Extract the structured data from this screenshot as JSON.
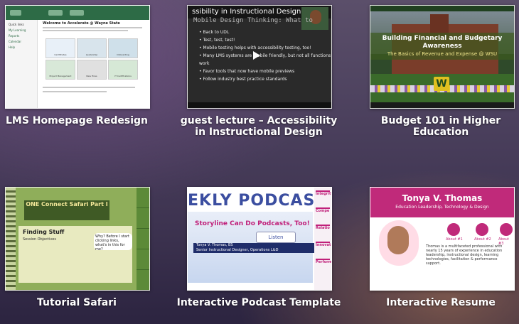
{
  "portfolio": {
    "items": [
      {
        "title": "LMS Homepage Redesign",
        "thumb": {
          "heading": "Welcome to Accelerate @ Wayne State",
          "side_items": [
            "Quick links",
            "My Learning",
            "Reports",
            "Calendar",
            "Help"
          ],
          "tiles": [
            "Certificates",
            "Leadership",
            "Onboarding",
            "Project Management",
            "New Hires",
            "IT Certifications"
          ]
        }
      },
      {
        "title": "guest lecture – Accessibility in Instructional Design",
        "thumb": {
          "bar_title": "ssibility in Instructional Designer",
          "slide_heading": "Mobile Design Thinking: What to",
          "bullets": [
            "Back to UDL",
            "Test, test, test!",
            "Mobile testing helps with accessibility testing, too!",
            "Many LMS systems are mobile friendly, but not all functions work",
            "Favor tools that now have mobile previews",
            "Follow industry best practice standards"
          ]
        }
      },
      {
        "title": "Budget 101 in Higher Education",
        "thumb": {
          "heading": "Building Financial and Budgetary Awareness",
          "subheading": "The Basics of Revenue and Expense @ WSU",
          "logo": "W"
        }
      },
      {
        "title": "Tutorial Safari",
        "thumb": {
          "banner": "ONE Connect Safari Part I",
          "page_heading": "Finding Stuff",
          "page_text": "Session Objectives",
          "bubble": "Why? Before I start clicking links, what's in this for me?"
        }
      },
      {
        "title": "Interactive Podcast Template",
        "thumb": {
          "heading": "EKLY PODCAST",
          "subtitle": "Storyline Can Do Podcasts, Too!",
          "button": "Listen",
          "speaker": "Tonya V. Thomas, BS",
          "speaker_role": "Senior Instructional Designer, Operations L&D",
          "side_tabs": [
            "Integrity",
            "Compe",
            "Relatio",
            "Innovat",
            "Perform"
          ]
        }
      },
      {
        "title": "Interactive Resume",
        "thumb": {
          "name": "Tonya V. Thomas",
          "subtitle": "Education Leadership, Technology & Design",
          "about": [
            "About #1",
            "About #2",
            "About #3"
          ],
          "bio": "Thomas is a multifaceted professional with nearly 15 years of experience in education leadership, instructional design, learning technologies, facilitation & performance support."
        }
      }
    ]
  }
}
